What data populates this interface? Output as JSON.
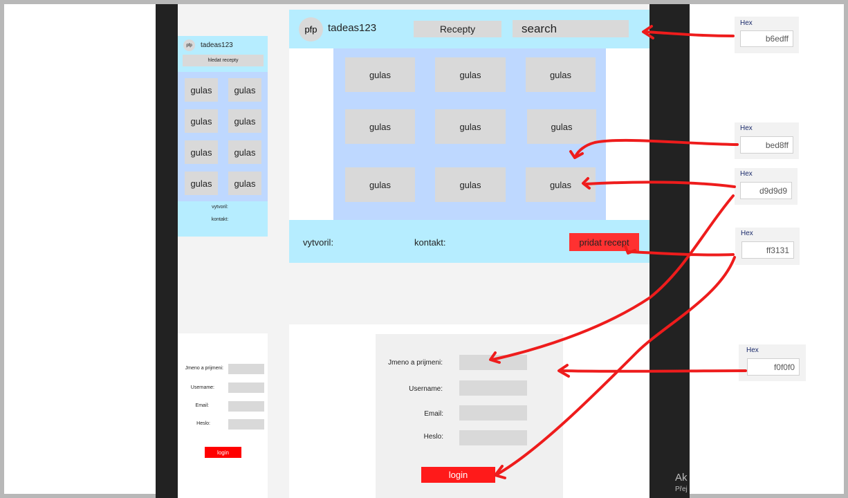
{
  "colors": {
    "light_blue": "#b6edff",
    "blue": "#bed8ff",
    "grey": "#d9d9d9",
    "red": "#ff3131",
    "form_bg": "#f0f0f0"
  },
  "small_mockup": {
    "avatar": "pfp",
    "username": "tadeas123",
    "search_button": "hledat recepty",
    "cards": [
      "gulas",
      "gulas",
      "gulas",
      "gulas",
      "gulas",
      "gulas",
      "gulas",
      "gulas"
    ],
    "footer_created": "vytvoril:",
    "footer_contact": "kontakt:"
  },
  "large_mockup": {
    "avatar": "pfp",
    "username": "tadeas123",
    "nav_button": "Recepty",
    "search_placeholder": "search",
    "cards": [
      "gulas",
      "gulas",
      "gulas",
      "gulas",
      "gulas",
      "gulas",
      "gulas",
      "gulas",
      "gulas"
    ],
    "footer_created": "vytvoril:",
    "footer_contact": "kontakt:",
    "add_recipe_button": "pridat recept"
  },
  "small_form": {
    "name_label": "Jmeno a prijmeni:",
    "username_label": "Username:",
    "email_label": "Email:",
    "password_label": "Heslo:",
    "login_button": "login"
  },
  "large_form": {
    "name_label": "Jmeno a prijmeni:",
    "username_label": "Username:",
    "email_label": "Email:",
    "password_label": "Heslo:",
    "login_button": "login"
  },
  "hex_swatches": [
    {
      "label": "Hex",
      "value": "b6edff"
    },
    {
      "label": "Hex",
      "value": "bed8ff"
    },
    {
      "label": "Hex",
      "value": "d9d9d9"
    },
    {
      "label": "Hex",
      "value": "ff3131"
    },
    {
      "label": "Hex",
      "value": "f0f0f0"
    }
  ],
  "watermark": {
    "line1": "Ak",
    "line2": "Přej"
  }
}
